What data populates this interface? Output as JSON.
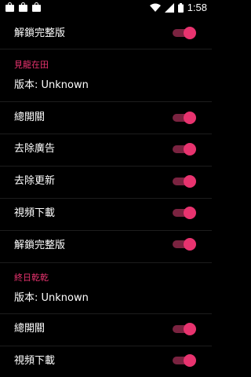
{
  "status_bar": {
    "time": "1:58",
    "left_icons": [
      "shopping-bag-icon",
      "shopping-bag-icon",
      "shopping-bag-icon"
    ],
    "right_icons": [
      "wifi-icon",
      "signal-icon",
      "battery-icon"
    ]
  },
  "colors": {
    "accent": "#e8336f",
    "track": "#7a2340",
    "background": "#000000"
  },
  "settings": {
    "top_item": {
      "label": "解鎖完整版",
      "enabled": true
    },
    "section1": {
      "title": "見龍在田",
      "version": "版本: Unknown",
      "items": [
        {
          "label": "總開關",
          "enabled": true
        },
        {
          "label": "去除廣告",
          "enabled": true
        },
        {
          "label": "去除更新",
          "enabled": true
        },
        {
          "label": "視頻下載",
          "enabled": true
        },
        {
          "label": "解鎖完整版",
          "enabled": true
        }
      ]
    },
    "section2": {
      "title": "終日乾乾",
      "version": "版本: Unknown",
      "items": [
        {
          "label": "總開關",
          "enabled": true
        },
        {
          "label": "視頻下載",
          "enabled": true
        }
      ]
    }
  }
}
